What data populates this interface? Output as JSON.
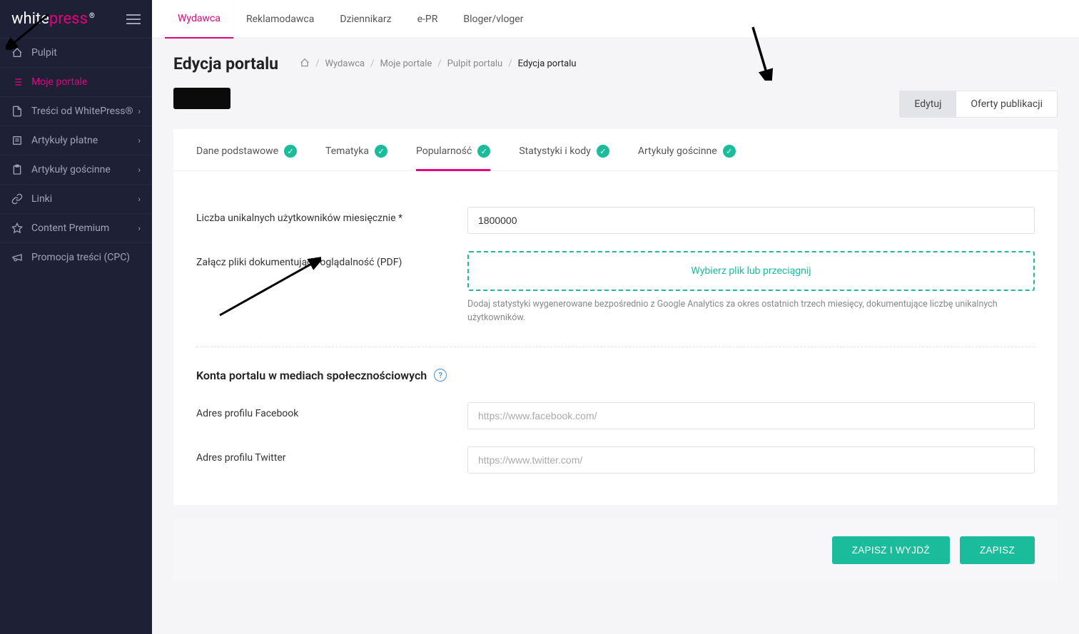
{
  "logo": {
    "white": "white",
    "press": "press",
    "reg": "®"
  },
  "sidebar": {
    "items": [
      {
        "label": "Pulpit",
        "icon": "home-icon",
        "active": false,
        "expandable": false
      },
      {
        "label": "Moje portale",
        "icon": "list-icon",
        "active": true,
        "expandable": false
      },
      {
        "label": "Treści od WhitePress®",
        "icon": "document-icon",
        "active": false,
        "expandable": true
      },
      {
        "label": "Artykuły płatne",
        "icon": "article-icon",
        "active": false,
        "expandable": true
      },
      {
        "label": "Artykuły gościnne",
        "icon": "clipboard-icon",
        "active": false,
        "expandable": true
      },
      {
        "label": "Linki",
        "icon": "link-icon",
        "active": false,
        "expandable": true
      },
      {
        "label": "Content Premium",
        "icon": "star-icon",
        "active": false,
        "expandable": true
      },
      {
        "label": "Promocja treści (CPC)",
        "icon": "megaphone-icon",
        "active": false,
        "expandable": false
      }
    ]
  },
  "topnav": {
    "tabs": [
      {
        "label": "Wydawca",
        "active": true
      },
      {
        "label": "Reklamodawca",
        "active": false
      },
      {
        "label": "Dziennikarz",
        "active": false
      },
      {
        "label": "e-PR",
        "active": false
      },
      {
        "label": "Bloger/vloger",
        "active": false
      }
    ]
  },
  "page": {
    "title": "Edycja portalu"
  },
  "breadcrumb": {
    "items": [
      "Wydawca",
      "Moje portale",
      "Pulpit portalu"
    ],
    "current": "Edycja portalu"
  },
  "action_tabs": {
    "edit": "Edytuj",
    "offers": "Oferty publikacji"
  },
  "inner_tabs": [
    {
      "label": "Dane podstawowe",
      "check": true,
      "active": false
    },
    {
      "label": "Tematyka",
      "check": true,
      "active": false
    },
    {
      "label": "Popularność",
      "check": true,
      "active": true
    },
    {
      "label": "Statystyki i kody",
      "check": true,
      "active": false
    },
    {
      "label": "Artykuły gościnne",
      "check": true,
      "active": false
    }
  ],
  "form": {
    "unique_users_label": "Liczba unikalnych użytkowników miesięcznie *",
    "unique_users_value": "1800000",
    "attach_label": "Załącz pliki dokumentujące oglądalność (PDF)",
    "upload_text": "Wybierz plik lub przeciągnij",
    "upload_help": "Dodaj statystyki wygenerowane bezpośrednio z Google Analytics za okres ostatnich trzech miesięcy, dokumentujące liczbę unikalnych użytkowników.",
    "social_section_title": "Konta portalu w mediach społecznościowych",
    "facebook_label": "Adres profilu Facebook",
    "facebook_placeholder": "https://www.facebook.com/",
    "twitter_label": "Adres profilu Twitter",
    "twitter_placeholder": "https://www.twitter.com/"
  },
  "buttons": {
    "save_exit": "ZAPISZ I WYJDŹ",
    "save": "ZAPISZ"
  },
  "colors": {
    "accent": "#e6007e",
    "success": "#1abc9c"
  }
}
